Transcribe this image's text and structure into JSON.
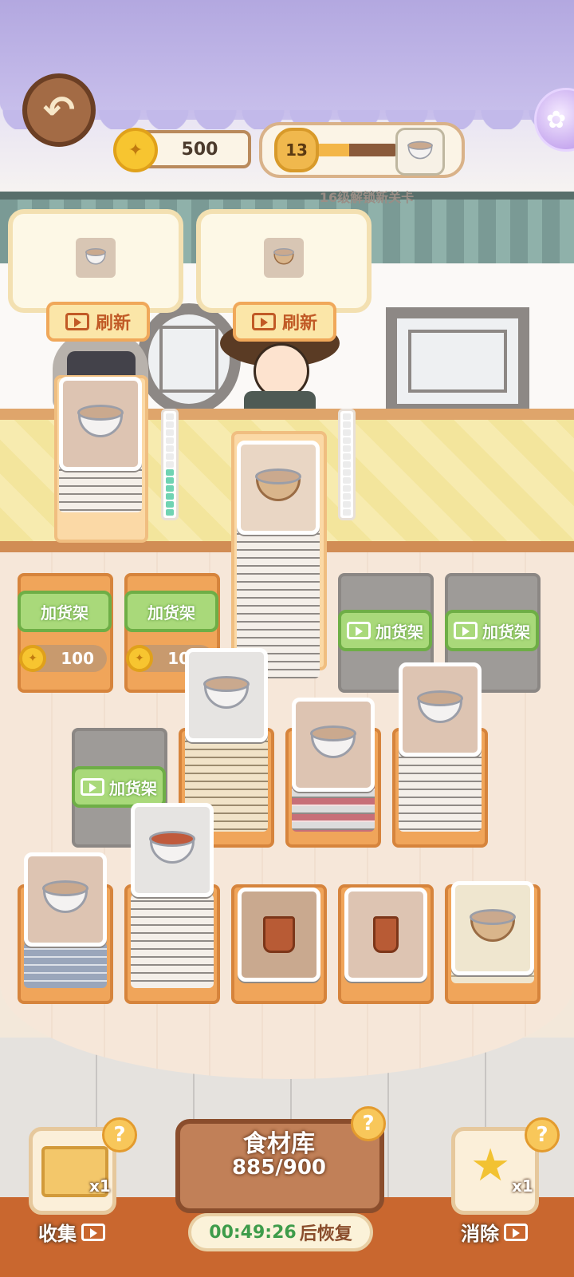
{
  "hud": {
    "coins": "500",
    "level": "13",
    "level_progress": 0.4,
    "unlock_hint": "16级解锁新关卡"
  },
  "orders": [
    {
      "refresh_label": "刷新",
      "item_icon": "bowl-icon"
    },
    {
      "refresh_label": "刷新",
      "item_icon": "wooden-bowl-icon"
    }
  ],
  "shelves": {
    "add_shelf_label": "加货架",
    "add_shelf_price": "100"
  },
  "meters": [
    {
      "filled": 6,
      "total": 13
    },
    {
      "filled": 0,
      "total": 13
    }
  ],
  "bottom": {
    "collect_label": "收集",
    "collect_count": "x1",
    "pantry_title": "食材库",
    "pantry_count": "885/900",
    "timer_value": "00:49:26",
    "timer_suffix": "后恢复",
    "remove_label": "消除",
    "remove_count": "x1",
    "help_glyph": "?"
  },
  "colors": {
    "accent_green": "#a9d97a",
    "accent_orange": "#f0a55a",
    "timer_green": "#3e9c4a",
    "timer_brown": "#8a4d2c"
  }
}
